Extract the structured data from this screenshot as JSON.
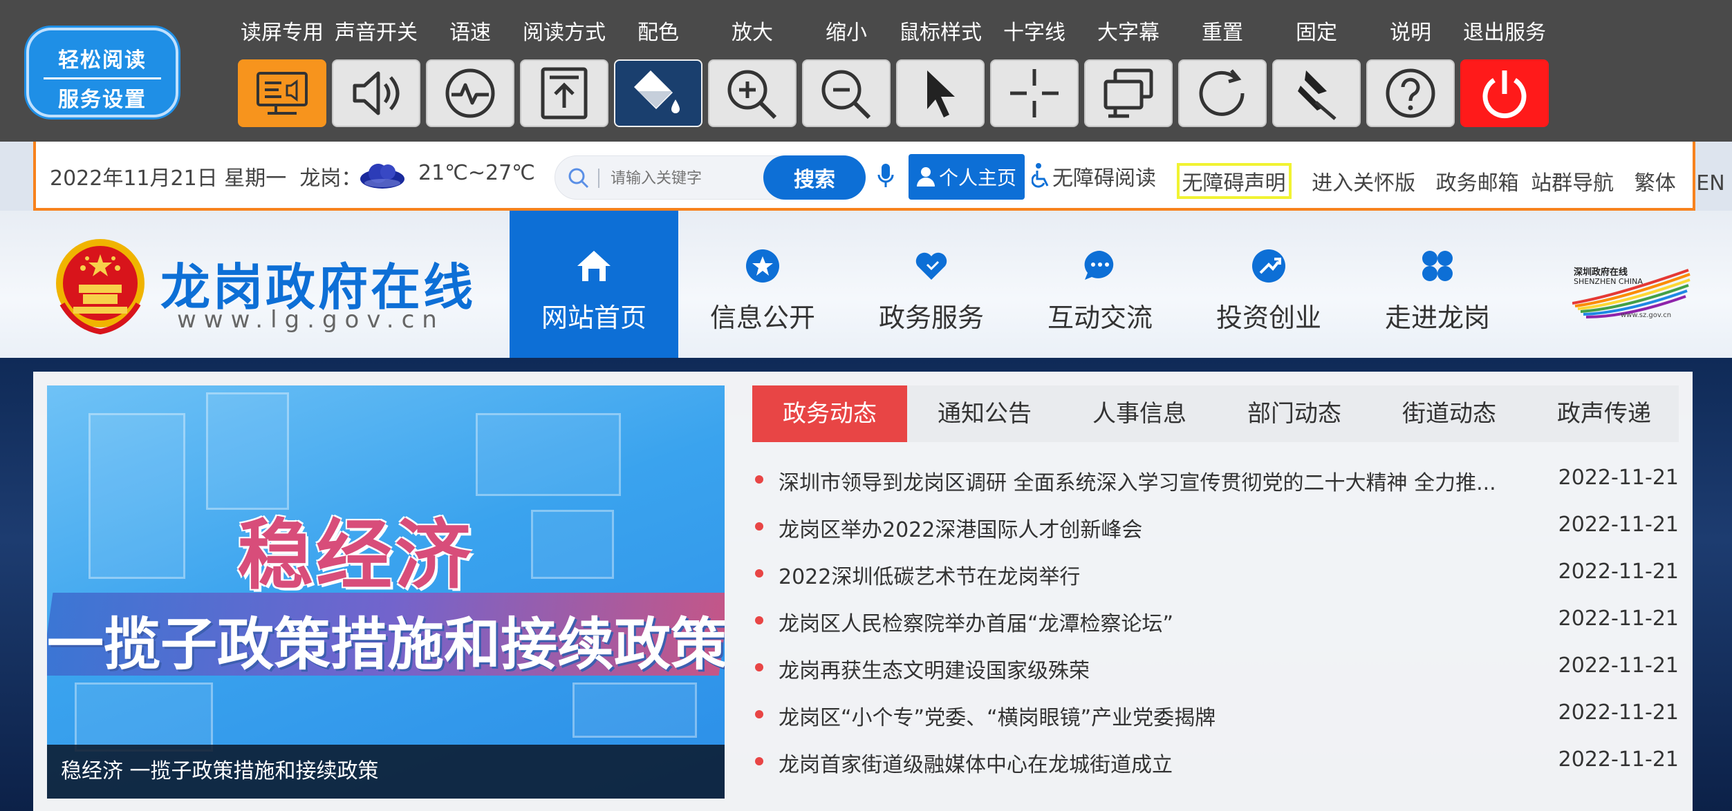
{
  "toolbar": {
    "logo_line1": "轻松阅读",
    "logo_line2": "服务设置",
    "tools": [
      {
        "label": "读屏专用",
        "icon": "screen-reader-icon"
      },
      {
        "label": "声音开关",
        "icon": "speaker-icon"
      },
      {
        "label": "语速",
        "icon": "speech-speed-icon"
      },
      {
        "label": "阅读方式",
        "icon": "reading-mode-icon"
      },
      {
        "label": "配色",
        "icon": "color-bucket-icon"
      },
      {
        "label": "放大",
        "icon": "zoom-in-icon"
      },
      {
        "label": "缩小",
        "icon": "zoom-out-icon"
      },
      {
        "label": "鼠标样式",
        "icon": "cursor-icon"
      },
      {
        "label": "十字线",
        "icon": "crosshair-icon"
      },
      {
        "label": "大字幕",
        "icon": "large-caption-icon"
      },
      {
        "label": "重置",
        "icon": "reset-icon"
      },
      {
        "label": "固定",
        "icon": "pin-icon"
      },
      {
        "label": "说明",
        "icon": "help-icon"
      },
      {
        "label": "退出服务",
        "icon": "power-icon"
      }
    ]
  },
  "infobar": {
    "date": "2022年11月21日 星期一",
    "location": "龙岗：",
    "temperature": "21℃~27℃",
    "search_placeholder": "请输入关键字",
    "search_button": "搜索",
    "personal_home": "个人主页",
    "links": [
      "无障碍阅读",
      "无障碍声明",
      "进入关怀版",
      "政务邮箱",
      "站群导航",
      "繁体",
      "EN"
    ]
  },
  "header": {
    "site_title": "龙岗政府在线",
    "site_url": "www.lg.gov.cn",
    "nav": [
      {
        "label": "网站首页",
        "icon": "home-icon"
      },
      {
        "label": "信息公开",
        "icon": "star-badge-icon"
      },
      {
        "label": "政务服务",
        "icon": "heart-icon"
      },
      {
        "label": "互动交流",
        "icon": "chat-icon"
      },
      {
        "label": "投资创业",
        "icon": "invest-icon"
      },
      {
        "label": "走进龙岗",
        "icon": "grid-icon"
      }
    ],
    "sz_logo_line1": "深圳政府在线",
    "sz_logo_line2": "SHENZHEN CHINA",
    "sz_logo_url": "www.sz.gov.cn"
  },
  "banner": {
    "headline": "稳经济",
    "subline": "一揽子政策措施和接续政策",
    "caption": "稳经济 一揽子政策措施和接续政策"
  },
  "tabs": [
    "政务动态",
    "通知公告",
    "人事信息",
    "部门动态",
    "街道动态",
    "政声传递"
  ],
  "colors": {
    "primary": "#0d6fd6",
    "accent_red": "#e84545",
    "toolbar_bg": "#4a4a4a",
    "orange": "#f7941d"
  },
  "news": [
    {
      "title": "深圳市领导到龙岗区调研 全面系统深入学习宣传贯彻党的二十大精神 全力推...",
      "date": "2022-11-21"
    },
    {
      "title": "龙岗区举办2022深港国际人才创新峰会",
      "date": "2022-11-21"
    },
    {
      "title": "2022深圳低碳艺术节在龙岗举行",
      "date": "2022-11-21"
    },
    {
      "title": "龙岗区人民检察院举办首届“龙潭检察论坛”",
      "date": "2022-11-21"
    },
    {
      "title": "龙岗再获生态文明建设国家级殊荣",
      "date": "2022-11-21"
    },
    {
      "title": "龙岗区“小个专”党委、“横岗眼镜”产业党委揭牌",
      "date": "2022-11-21"
    },
    {
      "title": "龙岗首家街道级融媒体中心在龙城街道成立",
      "date": "2022-11-21"
    }
  ]
}
